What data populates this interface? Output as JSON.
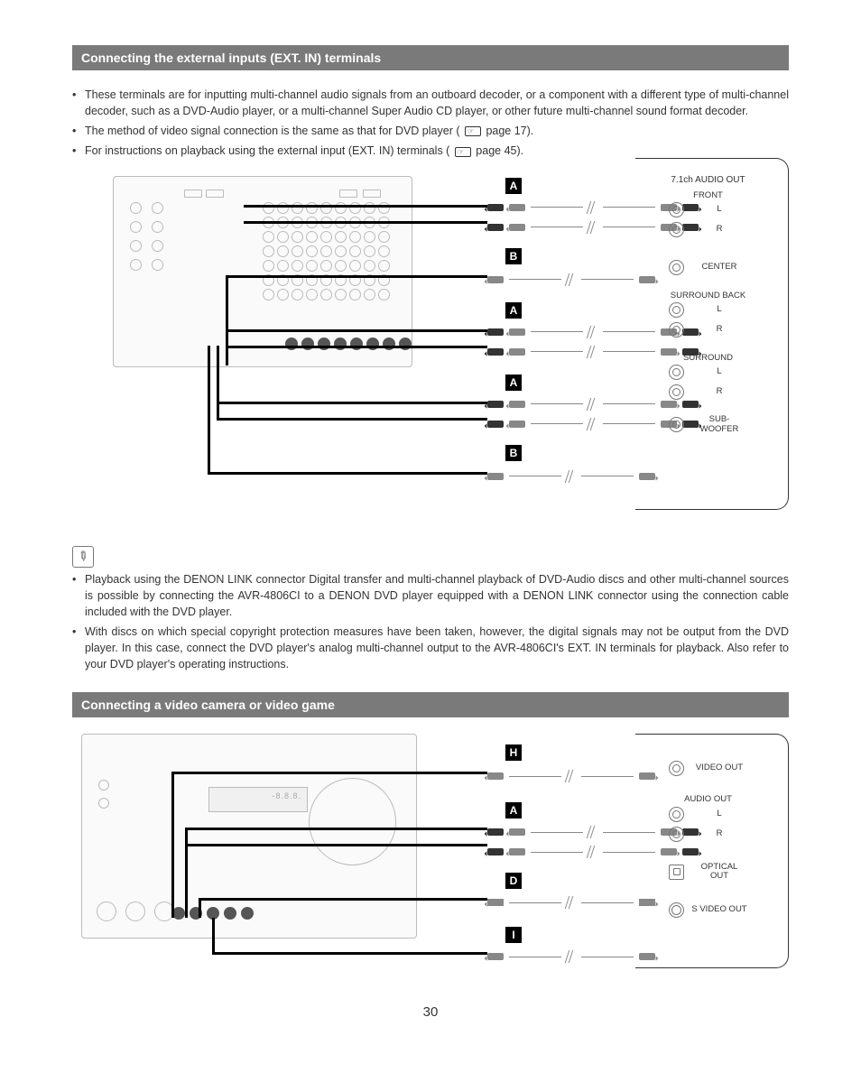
{
  "section1": {
    "title": "Connecting the external inputs (EXT. IN) terminals",
    "bullets": [
      "These terminals are for inputting multi-channel audio signals from an outboard decoder, or a component with a different type of multi-channel decoder, such as a DVD-Audio player, or a multi-channel Super Audio CD player, or other future multi-channel sound format decoder.",
      "The method of video signal connection is the same as that for DVD player (  page 17).",
      "For instructions on playback using the external input (EXT. IN) terminals (  page 45)."
    ],
    "note_bullets": [
      "Playback using the DENON LINK connector Digital transfer and multi-channel playback of DVD-Audio discs and other multi-channel sources is possible by connecting the AVR-4806CI to a DENON DVD player equipped with a DENON LINK connector using the connection cable included with the DVD player.",
      "With discs on which special copyright protection measures have been taken, however, the digital signals may not be output from the DVD player. In this case, connect the DVD player's analog multi-channel output to the AVR-4806CI's EXT. IN terminals for playback. Also refer to your DVD player's operating instructions."
    ]
  },
  "diagram1": {
    "tags": {
      "A": "A",
      "B": "B"
    },
    "header": "7.1ch AUDIO OUT",
    "groups": [
      {
        "tag": "A",
        "title": "FRONT",
        "rows": [
          "L",
          "R"
        ]
      },
      {
        "tag": "B",
        "title": "",
        "rows": [
          "CENTER"
        ]
      },
      {
        "tag": "A",
        "title": "SURROUND BACK",
        "rows": [
          "L",
          "R"
        ]
      },
      {
        "tag": "A",
        "title": "SURROUND",
        "rows": [
          "L",
          "R"
        ]
      },
      {
        "tag": "B",
        "title": "",
        "rows": [
          "SUB-\nWOOFER"
        ]
      }
    ]
  },
  "section2": {
    "title": "Connecting a video camera or video game"
  },
  "diagram2": {
    "display": "-8.8.8.",
    "header_audio": "AUDIO OUT",
    "groups": [
      {
        "tag": "H",
        "rows": [
          {
            "label": "VIDEO OUT",
            "type": "rca"
          }
        ]
      },
      {
        "tag": "A",
        "rows": [
          {
            "label": "L",
            "type": "rca"
          },
          {
            "label": "R",
            "type": "rca"
          }
        ]
      },
      {
        "tag": "D",
        "rows": [
          {
            "label": "OPTICAL OUT",
            "type": "sq"
          }
        ]
      },
      {
        "tag": "I",
        "rows": [
          {
            "label": "S VIDEO OUT",
            "type": "sv"
          }
        ]
      }
    ],
    "tags": {
      "H": "H",
      "A": "A",
      "D": "D",
      "I": "I"
    }
  },
  "page_number": "30"
}
